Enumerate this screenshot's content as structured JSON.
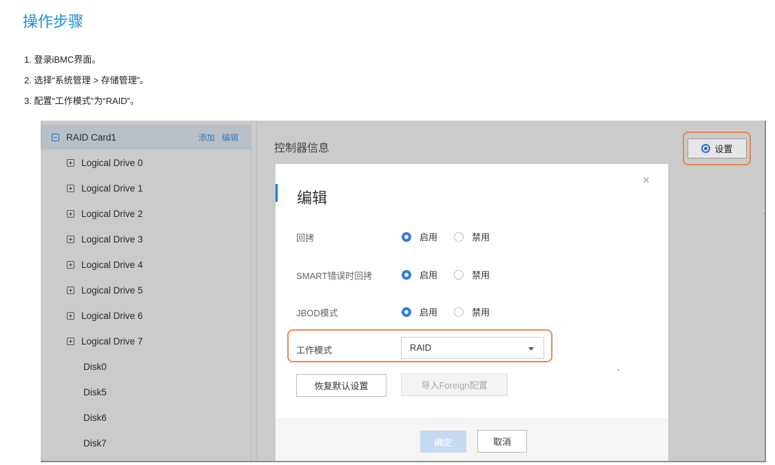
{
  "page": {
    "section_title": "操作步骤",
    "steps": [
      "1. 登录iBMC界面。",
      "2. 选择“系统管理 > 存储管理”。",
      "3. 配置“工作模式”为“RAID”。"
    ]
  },
  "sidebar": {
    "root": {
      "label": "RAID Card1",
      "add": "添加",
      "edit": "编辑"
    },
    "logical_drives": [
      "Logical Drive 0",
      "Logical Drive 1",
      "Logical Drive 2",
      "Logical Drive 3",
      "Logical Drive 4",
      "Logical Drive 5",
      "Logical Drive 6",
      "Logical Drive 7"
    ],
    "disks": [
      "Disk0",
      "Disk5",
      "Disk6",
      "Disk7"
    ]
  },
  "main": {
    "title": "控制器信息",
    "settings_label": "设置"
  },
  "dialog": {
    "title": "编辑",
    "close": "×",
    "options": {
      "enable": "启用",
      "disable": "禁用"
    },
    "fields": [
      {
        "label": "回拷",
        "value": "启用"
      },
      {
        "label": "SMART错误时回拷",
        "value": "启用"
      },
      {
        "label": "JBOD模式",
        "value": "启用"
      }
    ],
    "work_mode": {
      "label": "工作模式",
      "value": "RAID"
    },
    "restore_label": "恢复默认设置",
    "import_label": "导入Foreign配置",
    "ok_label": "确定",
    "cancel_label": "取消"
  },
  "colors": {
    "accent": "#2d7de0",
    "highlight": "#e8884e",
    "title_blue": "#1a8fd9"
  }
}
